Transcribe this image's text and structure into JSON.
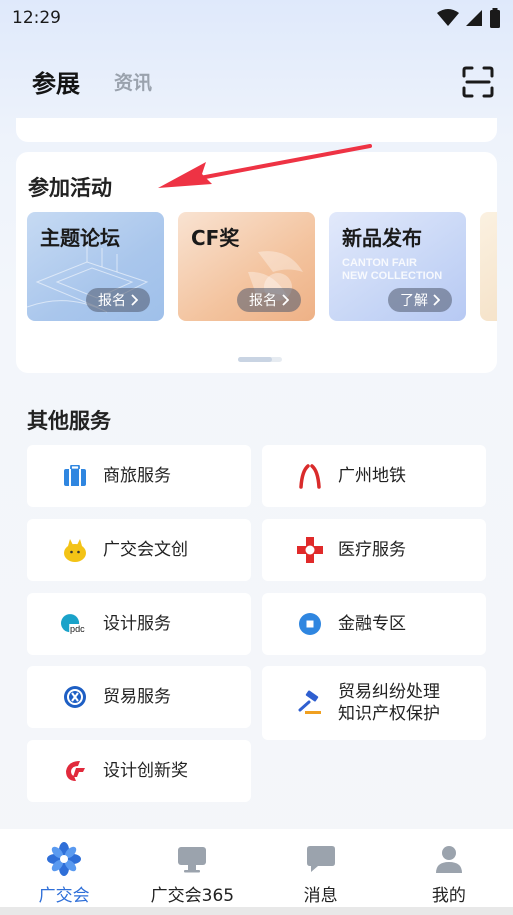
{
  "status": {
    "time": "12:29"
  },
  "header": {
    "tabs": [
      {
        "label": "参展",
        "active": true
      },
      {
        "label": "资讯",
        "active": false
      }
    ],
    "scan_icon": "scan-icon"
  },
  "activities": {
    "title": "参加活动",
    "items": [
      {
        "title": "主题论坛",
        "button": "报名"
      },
      {
        "title": "CF奖",
        "button": "报名"
      },
      {
        "title": "新品发布",
        "button": "了解",
        "overlay_text": [
          "CANTON FAIR",
          "NEW COLLECTION"
        ]
      }
    ]
  },
  "services": {
    "title": "其他服务",
    "items": [
      {
        "label": "商旅服务",
        "icon": "suitcase-icon"
      },
      {
        "label": "广州地铁",
        "icon": "metro-logo-icon"
      },
      {
        "label": "广交会文创",
        "icon": "mascot-icon"
      },
      {
        "label": "医疗服务",
        "icon": "medical-cross-icon"
      },
      {
        "label": "设计服务",
        "icon": "pdc-logo-icon",
        "icon_text": "pdc"
      },
      {
        "label": "金融专区",
        "icon": "finance-icon"
      },
      {
        "label": "贸易服务",
        "icon": "trade-icon"
      },
      {
        "label": "贸易纠纷处理\n知识产权保护",
        "line1": "贸易纠纷处理",
        "line2": "知识产权保护",
        "icon": "gavel-icon"
      },
      {
        "label": "设计创新奖",
        "icon": "design-award-icon"
      }
    ]
  },
  "tabbar": {
    "items": [
      {
        "label": "广交会",
        "icon": "flower-logo-icon",
        "active": true
      },
      {
        "label": "广交会365",
        "icon": "monitor-icon",
        "active": false
      },
      {
        "label": "消息",
        "icon": "chat-icon",
        "active": false
      },
      {
        "label": "我的",
        "icon": "user-icon",
        "active": false
      }
    ]
  },
  "colors": {
    "accent": "#2f6fd8",
    "annotation_arrow": "#ee3344",
    "metro_red": "#d92b2b",
    "medical_red": "#e02a2a",
    "finance_blue": "#2f86e0"
  }
}
